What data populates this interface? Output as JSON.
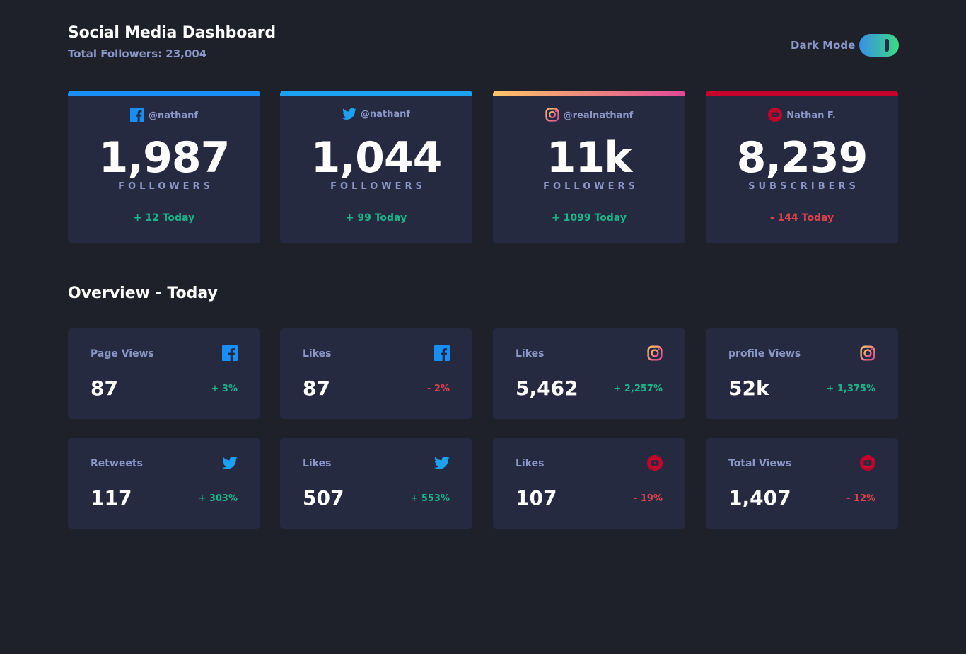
{
  "header": {
    "title": "Social Media Dashboard",
    "total_followers": "Total Followers: 23,004",
    "toggle_label": "Dark Mode"
  },
  "colors": {
    "background": "#1e202a",
    "card": "#252a41",
    "muted_text": "#8b97c6",
    "up": "#1db489",
    "down": "#dc414c",
    "facebook": "#198ff5",
    "twitter": "#1ca0f2",
    "youtube": "#c4032a"
  },
  "cards": [
    {
      "platform": "facebook-icon",
      "handle": "@nathanf",
      "count": "1,987",
      "unit": "FOLLOWERS",
      "change": "+ 12 Today",
      "trend": "up"
    },
    {
      "platform": "twitter-icon",
      "handle": "@nathanf",
      "count": "1,044",
      "unit": "FOLLOWERS",
      "change": "+ 99 Today",
      "trend": "up"
    },
    {
      "platform": "instagram-icon",
      "handle": "@realnathanf",
      "count": "11k",
      "unit": "FOLLOWERS",
      "change": "+ 1099 Today",
      "trend": "up"
    },
    {
      "platform": "youtube-icon",
      "handle": "Nathan F.",
      "count": "8,239",
      "unit": "SUBSCRIBERS",
      "change": "- 144 Today",
      "trend": "down"
    }
  ],
  "overview": {
    "title": "Overview - Today",
    "items": [
      {
        "label": "Page Views",
        "icon": "facebook-icon",
        "value": "87",
        "change": "+ 3%",
        "trend": "up"
      },
      {
        "label": "Likes",
        "icon": "facebook-icon",
        "value": "87",
        "change": "- 2%",
        "trend": "down"
      },
      {
        "label": "Likes",
        "icon": "instagram-icon",
        "value": "5,462",
        "change": "+ 2,257%",
        "trend": "up"
      },
      {
        "label": "profile Views",
        "icon": "instagram-icon",
        "value": "52k",
        "change": "+ 1,375%",
        "trend": "up"
      },
      {
        "label": "Retweets",
        "icon": "twitter-icon",
        "value": "117",
        "change": "+ 303%",
        "trend": "up"
      },
      {
        "label": "Likes",
        "icon": "twitter-icon",
        "value": "507",
        "change": "+ 553%",
        "trend": "up"
      },
      {
        "label": "Likes",
        "icon": "youtube-icon",
        "value": "107",
        "change": "- 19%",
        "trend": "down"
      },
      {
        "label": "Total Views",
        "icon": "youtube-icon",
        "value": "1,407",
        "change": "- 12%",
        "trend": "down"
      }
    ]
  }
}
